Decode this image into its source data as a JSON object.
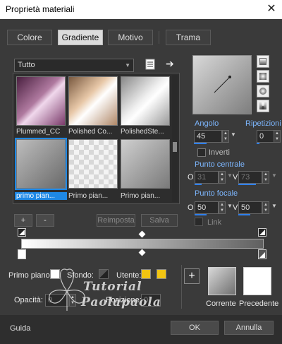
{
  "window": {
    "title": "Proprietà materiali",
    "close": "✕"
  },
  "tabs": {
    "colore": "Colore",
    "gradiente": "Gradiente",
    "motivo": "Motivo",
    "trama": "Trama"
  },
  "filter": {
    "value": "Tutto"
  },
  "swatches": [
    {
      "label": "Plummed_CC"
    },
    {
      "label": "Polished Co..."
    },
    {
      "label": "PolishedSte..."
    },
    {
      "label": "primo pian..."
    },
    {
      "label": "Primo pian..."
    },
    {
      "label": "Primo pian..."
    }
  ],
  "angle": {
    "label": "Angolo",
    "value": "45"
  },
  "repeats": {
    "label": "Ripetizioni",
    "value": "0"
  },
  "invert": {
    "label": "Inverti"
  },
  "center": {
    "label": "Punto centrale",
    "h_label": "O",
    "h": "31",
    "v_label": "V",
    "v": "73"
  },
  "focal": {
    "label": "Punto focale",
    "h_label": "O",
    "h": "50",
    "v_label": "V",
    "v": "50"
  },
  "link": {
    "label": "Link"
  },
  "buttons": {
    "add": "+",
    "remove": "-",
    "reset": "Reimposta",
    "save": "Salva",
    "ok": "OK",
    "cancel": "Annulla",
    "help": "Guida"
  },
  "colors": {
    "primo_label": "Primo piano:",
    "sfondo_label": "Sfondo:",
    "utente_label": "Utente:",
    "user_color_1": "#f2c511",
    "user_color_2": "#f2c511"
  },
  "opacity": {
    "label": "Opacità:",
    "value": "0"
  },
  "position": {
    "label": "Posizione:",
    "value": "0"
  },
  "preview": {
    "current": "Corrente",
    "previous": "Precedente"
  },
  "watermark": {
    "line1": "Tutorial",
    "line2": "Paolapaola"
  }
}
